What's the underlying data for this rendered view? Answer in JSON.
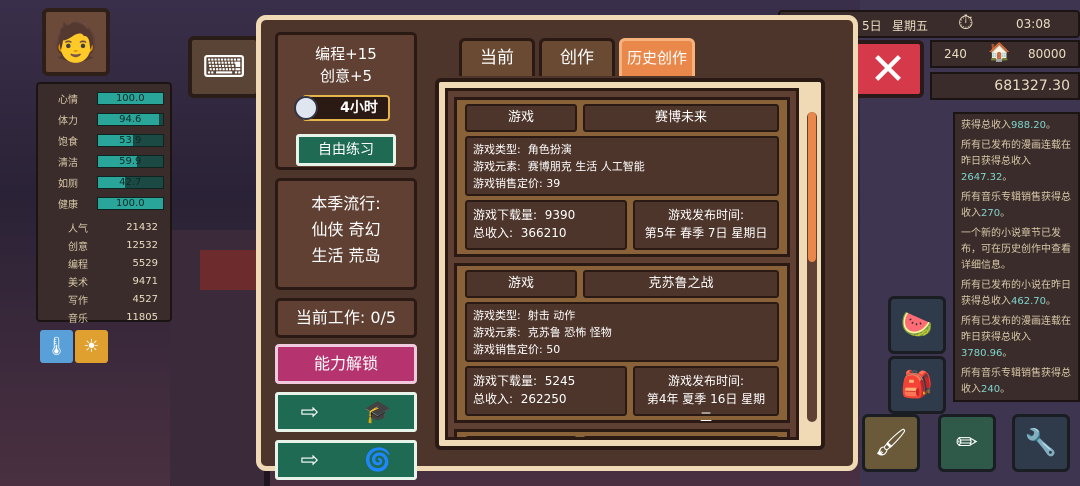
{
  "stats": [
    {
      "label": "心情",
      "value": "100.0",
      "pct": 1.0
    },
    {
      "label": "体力",
      "value": "94.6",
      "pct": 0.946
    },
    {
      "label": "饱食",
      "value": "53.9",
      "pct": 0.539
    },
    {
      "label": "清洁",
      "value": "59.9",
      "pct": 0.599
    },
    {
      "label": "如厕",
      "value": "42.7",
      "pct": 0.427
    },
    {
      "label": "健康",
      "value": "100.0",
      "pct": 1.0
    }
  ],
  "attributes": [
    {
      "label": "人气",
      "value": "21432"
    },
    {
      "label": "创意",
      "value": "12532"
    },
    {
      "label": "编程",
      "value": "5529"
    },
    {
      "label": "美术",
      "value": "9471"
    },
    {
      "label": "写作",
      "value": "4527"
    },
    {
      "label": "音乐",
      "value": "11805"
    }
  ],
  "topbar": {
    "date": "5日",
    "weekday": "星期五",
    "time": "03:08",
    "energy": "240",
    "house_value": "80000",
    "money": "681327.30"
  },
  "dialog": {
    "skill_gain": "编程+15",
    "creative_gain": "创意+5",
    "time_cost": "4小时",
    "practice_label": "自由练习",
    "trend_title": "本季流行:",
    "trend_line1": "仙侠 奇幻",
    "trend_line2": "生活 荒岛",
    "work_label": "当前工作: 0/5",
    "unlock_label": "能力解锁",
    "tabs": [
      "当前",
      "创作",
      "历史创作"
    ]
  },
  "games": [
    {
      "category": "游戏",
      "title": "赛博未来",
      "type_label": "游戏类型:",
      "type": "角色扮演",
      "elements_label": "游戏元素:",
      "elements": "赛博朋克 生活 人工智能",
      "price_label": "游戏销售定价:",
      "price": "39",
      "downloads_label": "游戏下载量:",
      "downloads": "9390",
      "income_label": "总收入:",
      "income": "366210",
      "release_label": "游戏发布时间:",
      "release": "第5年 春季 7日 星期日"
    },
    {
      "category": "游戏",
      "title": "克苏鲁之战",
      "type_label": "游戏类型:",
      "type": "射击 动作",
      "elements_label": "游戏元素:",
      "elements": "克苏鲁 恐怖 怪物",
      "price_label": "游戏销售定价:",
      "price": "50",
      "downloads_label": "游戏下载量:",
      "downloads": "5245",
      "income_label": "总收入:",
      "income": "262250",
      "release_label": "游戏发布时间:",
      "release": "第4年 夏季 16日 星期二"
    }
  ],
  "clipped_card": {
    "category": "游戏"
  },
  "news": [
    {
      "text": "获得总收入",
      "amount": "988.20",
      "end": "。"
    },
    {
      "text": "所有已发布的漫画连载在昨日获得总收入",
      "amount": "2647.32",
      "end": "。"
    },
    {
      "text": "所有音乐专辑销售获得总收入",
      "amount": "270",
      "end": "。"
    },
    {
      "text": "一个新的小说章节已发布，可在历史创作中查看详细信息。",
      "amount": "",
      "end": ""
    },
    {
      "text": "所有已发布的小说在昨日获得总收入",
      "amount": "462.70",
      "end": "。"
    },
    {
      "text": "所有已发布的漫画连载在昨日获得总收入",
      "amount": "3780.96",
      "end": "。"
    },
    {
      "text": "所有音乐专辑销售获得总收入",
      "amount": "240",
      "end": "。"
    }
  ]
}
